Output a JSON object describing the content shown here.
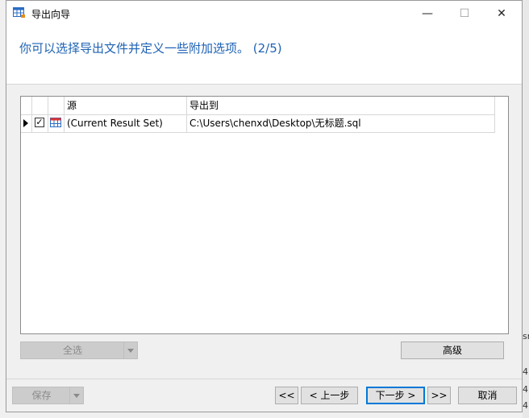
{
  "window": {
    "title": "导出向导"
  },
  "header": {
    "text": "你可以选择导出文件并定义一些附加选项。 (2/5)"
  },
  "grid": {
    "columns": {
      "source": "源",
      "target": "导出到"
    },
    "rows": [
      {
        "source": "(Current Result Set)",
        "target": "C:\\Users\\chenxd\\Desktop\\无标题.sql",
        "checked": "✓"
      }
    ]
  },
  "buttons": {
    "select_all": "全选",
    "advanced": "高级",
    "save": "保存",
    "first": "<<",
    "prev": "< 上一步",
    "next": "下一步 >",
    "last": ">>",
    "cancel": "取消"
  },
  "background": {
    "labels": [
      "sr",
      "4",
      "4",
      "4"
    ]
  },
  "colors": {
    "accent": "#1e62b4",
    "focus": "#0078d7"
  }
}
